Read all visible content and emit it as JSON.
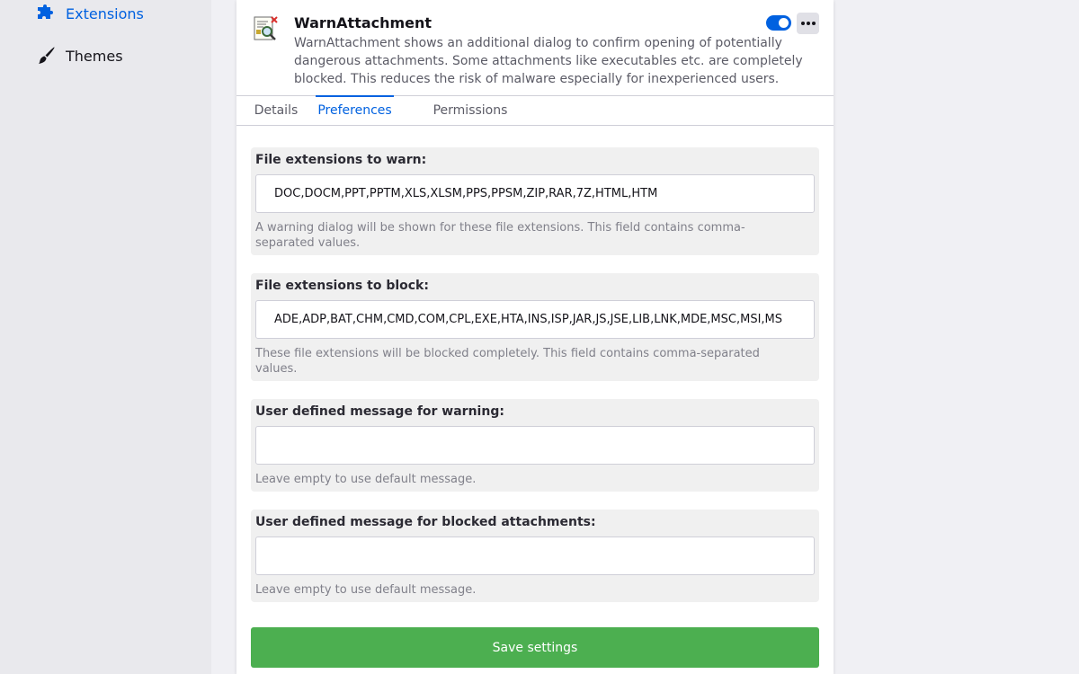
{
  "sidebar": {
    "items": [
      {
        "label": "Extensions",
        "icon": "puzzle-piece-icon",
        "active": true
      },
      {
        "label": "Themes",
        "icon": "paintbrush-icon",
        "active": false
      }
    ]
  },
  "addon": {
    "name": "WarnAttachment",
    "description": "WarnAttachment shows an additional dialog to confirm opening of potentially dangerous attachments. Some attachments like executables etc. are completely blocked. This reduces the risk of malware especially for inexperienced users.",
    "enabled": true,
    "icon": "attachment-warning-icon",
    "more_icon": "more-options-icon"
  },
  "tabs": [
    {
      "label": "Details",
      "active": false
    },
    {
      "label": "Preferences",
      "active": true
    },
    {
      "label": "Permissions",
      "active": false
    }
  ],
  "preferences": {
    "warn_extensions": {
      "label": "File extensions to warn:",
      "value": "DOC,DOCM,PPT,PPTM,XLS,XLSM,PPS,PPSM,ZIP,RAR,7Z,HTML,HTM",
      "help": "A warning dialog will be shown for these file extensions. This field contains comma-separated values."
    },
    "block_extensions": {
      "label": "File extensions to block:",
      "value": "ADE,ADP,BAT,CHM,CMD,COM,CPL,EXE,HTA,INS,ISP,JAR,JS,JSE,LIB,LNK,MDE,MSC,MSI,MS",
      "help": "These file extensions will be blocked completely. This field contains comma-separated values."
    },
    "warn_message": {
      "label": "User defined message for warning:",
      "value": "",
      "help": "Leave empty to use default message."
    },
    "block_message": {
      "label": "User defined message for blocked attachments:",
      "value": "",
      "help": "Leave empty to use default message."
    }
  },
  "save_label": "Save settings",
  "colors": {
    "accent": "#0061e0",
    "save_button": "#4caf50"
  }
}
